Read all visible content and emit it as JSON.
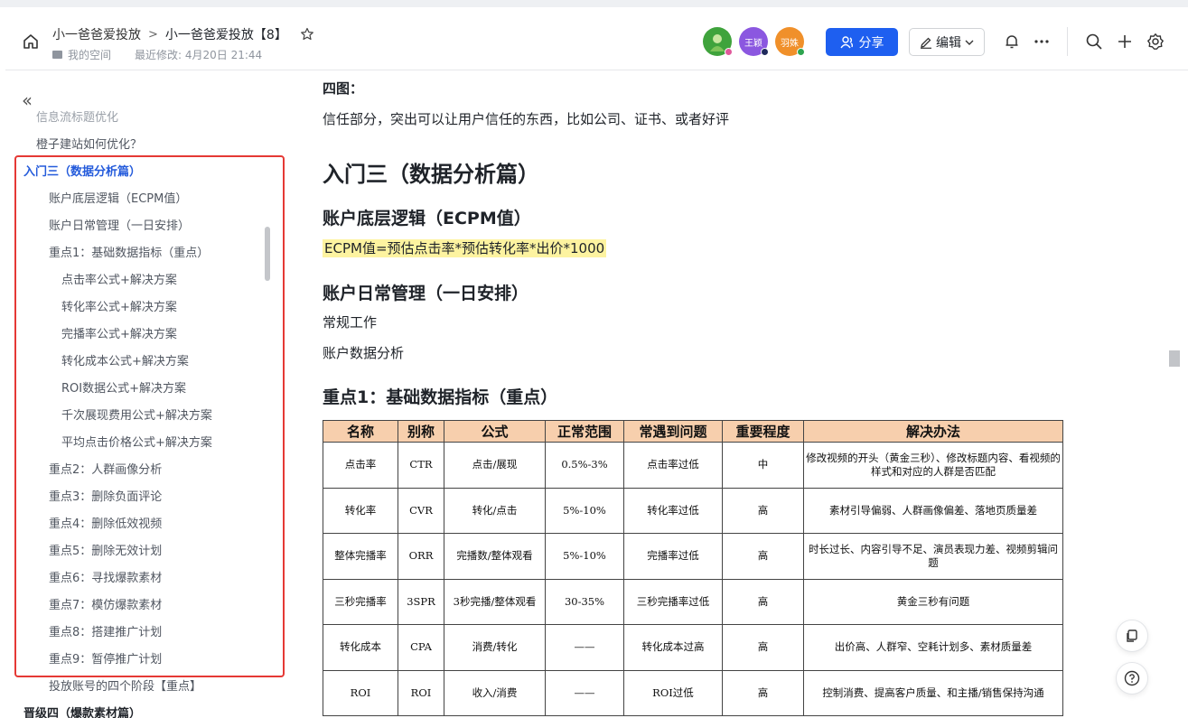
{
  "breadcrumb": {
    "parent": "小一爸爸爱投放",
    "separator": ">",
    "current": "小一爸爸爱投放【8】"
  },
  "meta": {
    "space": "我的空间",
    "modified": "最近修改: 4月20日 21:44"
  },
  "avatars": [
    {
      "label": "",
      "color": "#3fa33c",
      "status": "#e0599b"
    },
    {
      "label": "王颖",
      "color": "#8b57e0",
      "status": "#1f2a5c"
    },
    {
      "label": "羽姝",
      "color": "#f0902a",
      "status": "#2ea44f"
    }
  ],
  "toolbar": {
    "share_label": "分享",
    "edit_label": "编辑"
  },
  "sidebar": {
    "items": [
      {
        "label": "信息流标题优化",
        "level": "l1",
        "style": "cut"
      },
      {
        "label": "橙子建站如何优化？",
        "level": "l1",
        "style": ""
      },
      {
        "label": "入门三（数据分析篇）",
        "level": "l0",
        "style": "active"
      },
      {
        "label": "账户底层逻辑（ECPM值）",
        "level": "l2",
        "style": ""
      },
      {
        "label": "账户日常管理（一日安排）",
        "level": "l2",
        "style": ""
      },
      {
        "label": "重点1：基础数据指标（重点）",
        "level": "l2",
        "style": ""
      },
      {
        "label": "点击率公式+解决方案",
        "level": "l3",
        "style": ""
      },
      {
        "label": "转化率公式+解决方案",
        "level": "l3",
        "style": ""
      },
      {
        "label": "完播率公式+解决方案",
        "level": "l3",
        "style": ""
      },
      {
        "label": "转化成本公式+解决方案",
        "level": "l3",
        "style": ""
      },
      {
        "label": "ROI数据公式+解决方案",
        "level": "l3",
        "style": ""
      },
      {
        "label": "千次展现费用公式+解决方案",
        "level": "l3",
        "style": ""
      },
      {
        "label": "平均点击价格公式+解决方案",
        "level": "l3",
        "style": ""
      },
      {
        "label": "重点2：人群画像分析",
        "level": "l2",
        "style": ""
      },
      {
        "label": "重点3：删除负面评论",
        "level": "l2",
        "style": ""
      },
      {
        "label": "重点4：删除低效视频",
        "level": "l2",
        "style": ""
      },
      {
        "label": "重点5：删除无效计划",
        "level": "l2",
        "style": ""
      },
      {
        "label": "重点6：寻找爆款素材",
        "level": "l2",
        "style": ""
      },
      {
        "label": "重点7：模仿爆款素材",
        "level": "l2",
        "style": ""
      },
      {
        "label": "重点8：搭建推广计划",
        "level": "l2",
        "style": ""
      },
      {
        "label": "重点9：暂停推广计划",
        "level": "l2",
        "style": ""
      },
      {
        "label": "投放账号的四个阶段【重点】",
        "level": "l2",
        "style": ""
      },
      {
        "label": "晋级四（爆款素材篇）",
        "level": "l0",
        "style": "bold"
      }
    ]
  },
  "doc": {
    "p_sitou": "四图：",
    "p_trust": "信任部分，突出可以让用户信任的东西，比如公司、证书、或者好评",
    "h1": "入门三（数据分析篇）",
    "h2_ecpm": "账户底层逻辑（ECPM值）",
    "ecpm_formula": "ECPM值=预估点击率*预估转化率*出价*1000",
    "h2_daily": "账户日常管理（一日安排）",
    "p_routine": "常规工作",
    "p_analysis": "账户数据分析",
    "h2_key1": "重点1：基础数据指标（重点）"
  },
  "table": {
    "headers": [
      "名称",
      "别称",
      "公式",
      "正常范围",
      "常遇到问题",
      "重要程度",
      "解决办法"
    ],
    "rows": [
      [
        "点击率",
        "CTR",
        "点击/展现",
        "0.5%-3%",
        "点击率过低",
        "中",
        "修改视频的开头（黄金三秒）、修改标题内容、看视频的样式和对应的人群是否匹配"
      ],
      [
        "转化率",
        "CVR",
        "转化/点击",
        "5%-10%",
        "转化率过低",
        "高",
        "素材引导偏弱、人群画像偏差、落地页质量差"
      ],
      [
        "整体完播率",
        "ORR",
        "完播数/整体观看",
        "5%-10%",
        "完播率过低",
        "高",
        "时长过长、内容引导不足、演员表现力差、视频剪辑问题"
      ],
      [
        "三秒完播率",
        "3SPR",
        "3秒完播/整体观看",
        "30-35%",
        "三秒完播率过低",
        "高",
        "黄金三秒有问题"
      ],
      [
        "转化成本",
        "CPA",
        "消费/转化",
        "——",
        "转化成本过高",
        "高",
        "出价高、人群窄、空耗计划多、素材质量差"
      ],
      [
        "ROI",
        "ROI",
        "收入/消费",
        "——",
        "ROI过低",
        "高",
        "控制消费、提高客户质量、和主播/销售保持沟通"
      ]
    ]
  },
  "colors": {
    "accent": "#1e5ff0",
    "active_toc": "#245bdb",
    "highlight": "#fdf3a0",
    "table_header": "#f7cfad",
    "annotation_box": "#e53935"
  }
}
